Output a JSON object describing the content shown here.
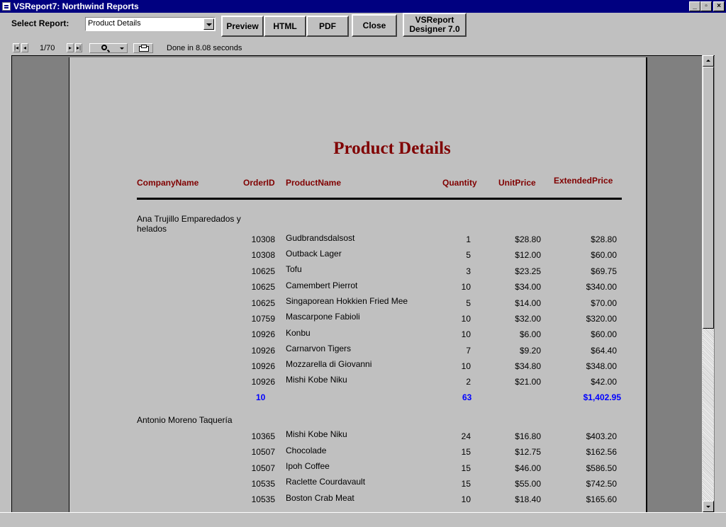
{
  "window": {
    "title": "VSReport7: Northwind Reports"
  },
  "toolbar": {
    "select_label": "Select Report:",
    "selected_report": "Product Details",
    "buttons": [
      "Preview",
      "HTML",
      "PDF",
      "Close",
      "VSReport Designer 7.0"
    ]
  },
  "navigator": {
    "page": "1/70",
    "status": "Done in 8.08 seconds"
  },
  "report": {
    "title": "Product Details",
    "headers": [
      "CompanyName",
      "OrderID",
      "ProductName",
      "Quantity",
      "UnitPrice",
      "ExtendedPrice"
    ],
    "groups": [
      {
        "company": "Ana Trujillo Emparedados y helados",
        "rows": [
          [
            "10308",
            "Gudbrandsdalsost",
            "1",
            "$28.80",
            "$28.80"
          ],
          [
            "10308",
            "Outback Lager",
            "5",
            "$12.00",
            "$60.00"
          ],
          [
            "10625",
            "Tofu",
            "3",
            "$23.25",
            "$69.75"
          ],
          [
            "10625",
            "Camembert Pierrot",
            "10",
            "$34.00",
            "$340.00"
          ],
          [
            "10625",
            "Singaporean Hokkien Fried Mee",
            "5",
            "$14.00",
            "$70.00"
          ],
          [
            "10759",
            "Mascarpone Fabioli",
            "10",
            "$32.00",
            "$320.00"
          ],
          [
            "10926",
            "Konbu",
            "10",
            "$6.00",
            "$60.00"
          ],
          [
            "10926",
            "Carnarvon Tigers",
            "7",
            "$9.20",
            "$64.40"
          ],
          [
            "10926",
            "Mozzarella di Giovanni",
            "10",
            "$34.80",
            "$348.00"
          ],
          [
            "10926",
            "Mishi Kobe Niku",
            "2",
            "$21.00",
            "$42.00"
          ]
        ],
        "totals": {
          "count": "10",
          "quantity": "63",
          "extended": "$1,402.95"
        }
      },
      {
        "company": "Antonio Moreno Taquería",
        "rows": [
          [
            "10365",
            "Mishi Kobe Niku",
            "24",
            "$16.80",
            "$403.20"
          ],
          [
            "10507",
            "Chocolade",
            "15",
            "$12.75",
            "$162.56"
          ],
          [
            "10507",
            "Ipoh Coffee",
            "15",
            "$46.00",
            "$586.50"
          ],
          [
            "10535",
            "Raclette Courdavault",
            "15",
            "$55.00",
            "$742.50"
          ],
          [
            "10535",
            "Boston Crab Meat",
            "10",
            "$18.40",
            "$165.60"
          ]
        ]
      }
    ]
  }
}
